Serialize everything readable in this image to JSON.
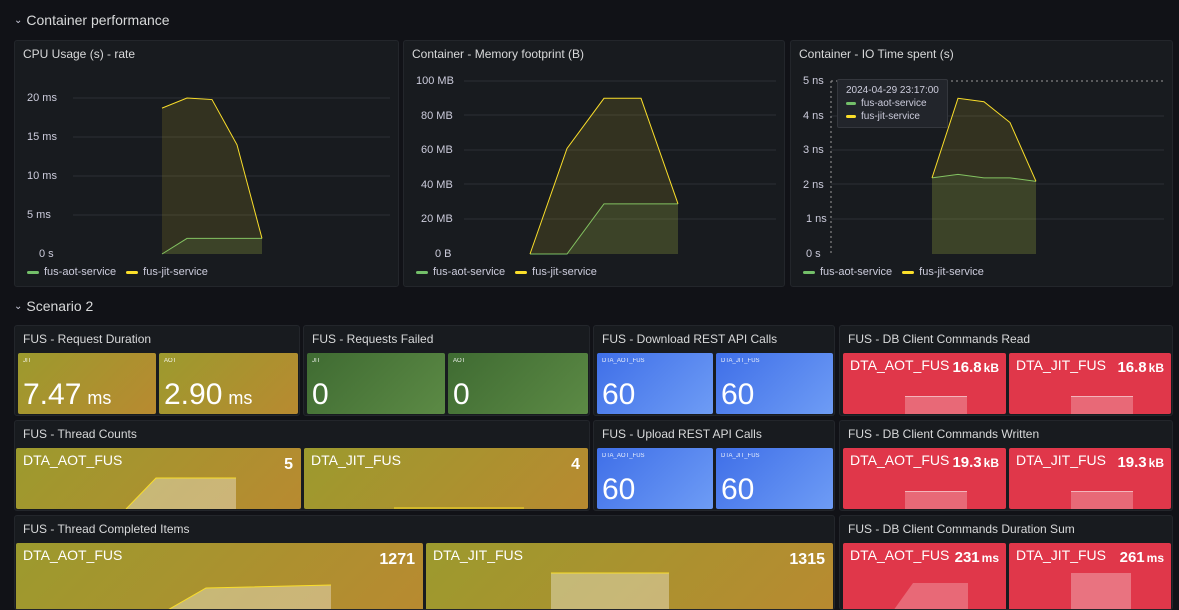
{
  "rows": {
    "container": {
      "label": "Container performance"
    },
    "scenario": {
      "label": "Scenario 2"
    }
  },
  "colors": {
    "green": "#73bf69",
    "yellow": "#fade2a",
    "olive": "#a89b2a",
    "greenTile": "#4f7f3a",
    "blueTile": "#4a78f0",
    "redTile": "#e0374a"
  },
  "legend": {
    "aot": "fus-aot-service",
    "jit": "fus-jit-service"
  },
  "panels": {
    "cpu": {
      "title": "CPU Usage (s) - rate",
      "yticks": [
        "20 ms",
        "15 ms",
        "10 ms",
        "5 ms",
        "0 s"
      ]
    },
    "mem": {
      "title": "Container - Memory footprint (B)",
      "yticks": [
        "100 MB",
        "80 MB",
        "60 MB",
        "40 MB",
        "20 MB",
        "0 B"
      ]
    },
    "io": {
      "title": "Container - IO Time spent (s)",
      "yticks": [
        "5 ns",
        "4 ns",
        "3 ns",
        "2 ns",
        "1 ns",
        "0 s"
      ],
      "tooltip": {
        "time": "2024-04-29 23:17:00",
        "aot": "fus-aot-service",
        "jit": "fus-jit-service"
      }
    },
    "reqDur": {
      "title": "FUS - Request Duration",
      "a_label": "JIT",
      "a_val": "7.47",
      "a_unit": "ms",
      "b_label": "AOT",
      "b_val": "2.90",
      "b_unit": "ms"
    },
    "reqFail": {
      "title": "FUS - Requests Failed",
      "a_label": "JIT",
      "a_val": "0",
      "b_label": "AOT",
      "b_val": "0"
    },
    "download": {
      "title": "FUS - Download REST API Calls",
      "a_label": "DTA_AOT_FUS",
      "a_val": "60",
      "b_label": "DTA_JIT_FUS",
      "b_val": "60"
    },
    "dbRead": {
      "title": "FUS - DB Client Commands Read",
      "a_label": "DTA_AOT_FUS",
      "a_val": "16.8",
      "a_unit": "kB",
      "b_label": "DTA_JIT_FUS",
      "b_val": "16.8",
      "b_unit": "kB"
    },
    "threads": {
      "title": "FUS - Thread Counts",
      "a_label": "DTA_AOT_FUS",
      "a_val": "5",
      "b_label": "DTA_JIT_FUS",
      "b_val": "4"
    },
    "upload": {
      "title": "FUS - Upload REST API Calls",
      "a_label": "DTA_AOT_FUS",
      "a_val": "60",
      "b_label": "DTA_JIT_FUS",
      "b_val": "60"
    },
    "dbWritten": {
      "title": "FUS - DB Client Commands Written",
      "a_label": "DTA_AOT_FUS",
      "a_val": "19.3",
      "a_unit": "kB",
      "b_label": "DTA_JIT_FUS",
      "b_val": "19.3",
      "b_unit": "kB"
    },
    "completed": {
      "title": "FUS - Thread Completed Items",
      "a_label": "DTA_AOT_FUS",
      "a_val": "1271",
      "b_label": "DTA_JIT_FUS",
      "b_val": "1315"
    },
    "dbDur": {
      "title": "FUS - DB Client Commands Duration Sum",
      "a_label": "DTA_AOT_FUS",
      "a_val": "231",
      "a_unit": "ms",
      "b_label": "DTA_JIT_FUS",
      "b_val": "261",
      "b_unit": "ms"
    }
  },
  "chart_data": [
    {
      "type": "area",
      "series": [
        {
          "name": "fus-aot-service",
          "values": [
            0,
            2,
            2,
            2,
            2
          ]
        },
        {
          "name": "fus-jit-service",
          "values": [
            18.7,
            20,
            19.8,
            14,
            2
          ]
        }
      ],
      "ylim": [
        0,
        20
      ]
    },
    {
      "type": "area",
      "series": [
        {
          "name": "fus-aot-service",
          "values": [
            0,
            0,
            29,
            29,
            29
          ]
        },
        {
          "name": "fus-jit-service",
          "values": [
            0,
            61,
            90,
            90,
            29
          ]
        }
      ],
      "ylim": [
        0,
        100
      ]
    },
    {
      "type": "area",
      "series": [
        {
          "name": "fus-aot-service",
          "values": [
            2.2,
            2.3,
            2.2,
            2.2,
            2.1
          ]
        },
        {
          "name": "fus-jit-service",
          "values": [
            2.2,
            4.5,
            4.4,
            3.8,
            2.1
          ]
        }
      ],
      "ylim": [
        0,
        5
      ]
    }
  ]
}
